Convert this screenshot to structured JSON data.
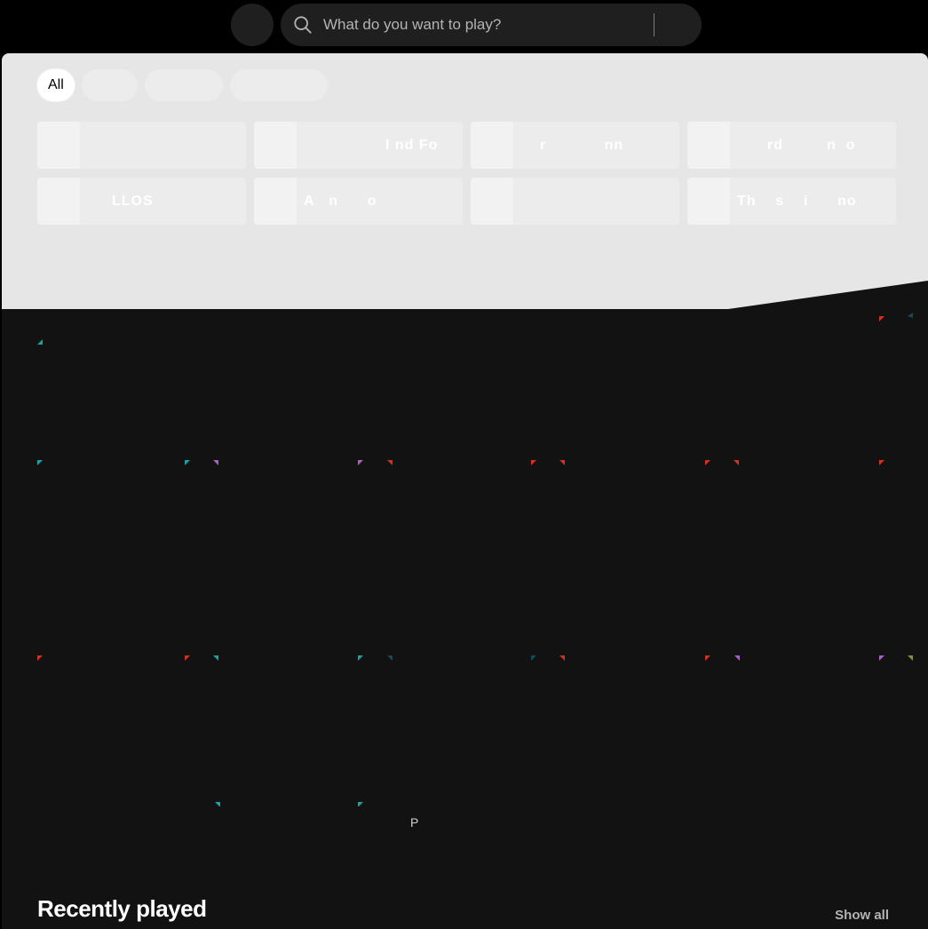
{
  "search": {
    "placeholder": "What do you want to play?"
  },
  "filters": {
    "active_label": "All"
  },
  "shortcuts": [
    {
      "label": ""
    },
    {
      "label": "I nd Fo"
    },
    {
      "label": "r            nn"
    },
    {
      "label": "rd         n  o"
    },
    {
      "label": "LLOS"
    },
    {
      "label": "A   n      o"
    },
    {
      "label": ""
    },
    {
      "label": "Th    s    i      no"
    }
  ],
  "sections": {
    "recent_title": "Recently played",
    "show_all": "Show all",
    "stray_text": "P"
  },
  "colors": {
    "panel": "#121212",
    "hero": "#e6e6e6",
    "accent_teal": "#1ba1a1",
    "accent_red": "#d4301f",
    "accent_purple": "#a95fc4"
  }
}
